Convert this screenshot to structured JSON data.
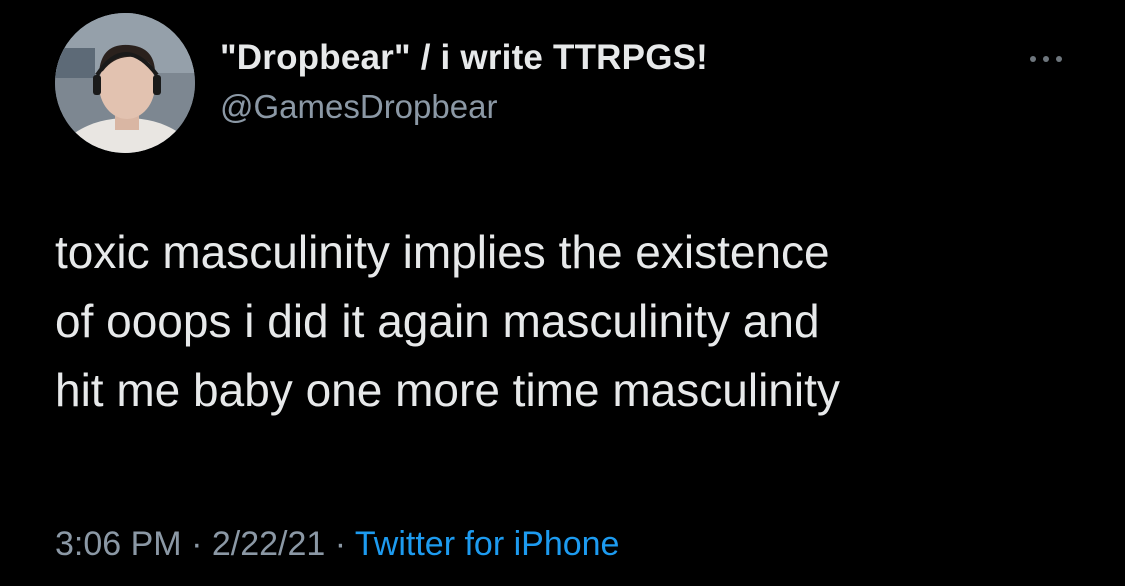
{
  "user": {
    "display_name": "\"Dropbear\" / i write TTRPGS!",
    "handle": "@GamesDropbear"
  },
  "tweet": {
    "lines": [
      "toxic masculinity implies the existence",
      "of ooops i did it again masculinity and",
      "hit me baby one more time masculinity"
    ]
  },
  "meta": {
    "time": "3:06 PM",
    "separator": " · ",
    "date": "2/22/21",
    "source": "Twitter for iPhone"
  },
  "icons": {
    "more": "more-horizontal-icon",
    "avatar": "profile-photo"
  },
  "colors": {
    "background": "#000000",
    "primary_text": "#e7e9ea",
    "secondary_text": "#8b98a5",
    "link": "#1d9bf0"
  }
}
